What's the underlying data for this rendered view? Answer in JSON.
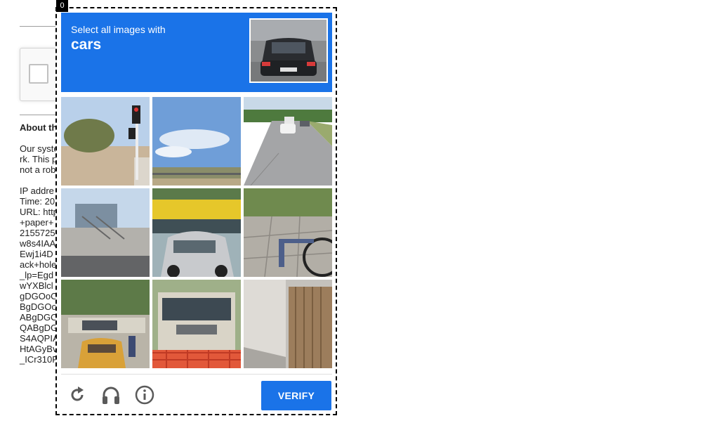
{
  "dialog": {
    "index_badge": "0",
    "prompt": "Select all images with",
    "object": "cars",
    "verify_label": "VERIFY",
    "controls": [
      {
        "icon": "reload-icon"
      },
      {
        "icon": "headphones-icon"
      },
      {
        "icon": "info-icon"
      }
    ],
    "accent_color": "#1a73e8",
    "tiles": [
      {
        "content": "traffic light in desert roadside"
      },
      {
        "content": "blue sky over field"
      },
      {
        "content": "road with cars"
      },
      {
        "content": "highway overpass"
      },
      {
        "content": "silver car near yellow bus"
      },
      {
        "content": "bicycle on sidewalk"
      },
      {
        "content": "street with taxi and bus"
      },
      {
        "content": "bus with red barrier"
      },
      {
        "content": "wooden fence"
      }
    ]
  },
  "background_page": {
    "about_title": "About th",
    "para1": [
      "Our syste",
      "rk. This p",
      "not a rob"
    ],
    "details": [
      "IP addre",
      "Time: 20",
      "URL: http",
      "+paper+",
      "2155725",
      "w8s4IAA",
      "Ewj1i4D",
      "ack+hole",
      "_lp=Egd",
      "wYXBlcl",
      "gDGOoC",
      "BgDGOo",
      "ABgDGO",
      "QABgDG",
      "S4AQPIA",
      "HtAGyBv",
      "_ICr310F"
    ]
  }
}
